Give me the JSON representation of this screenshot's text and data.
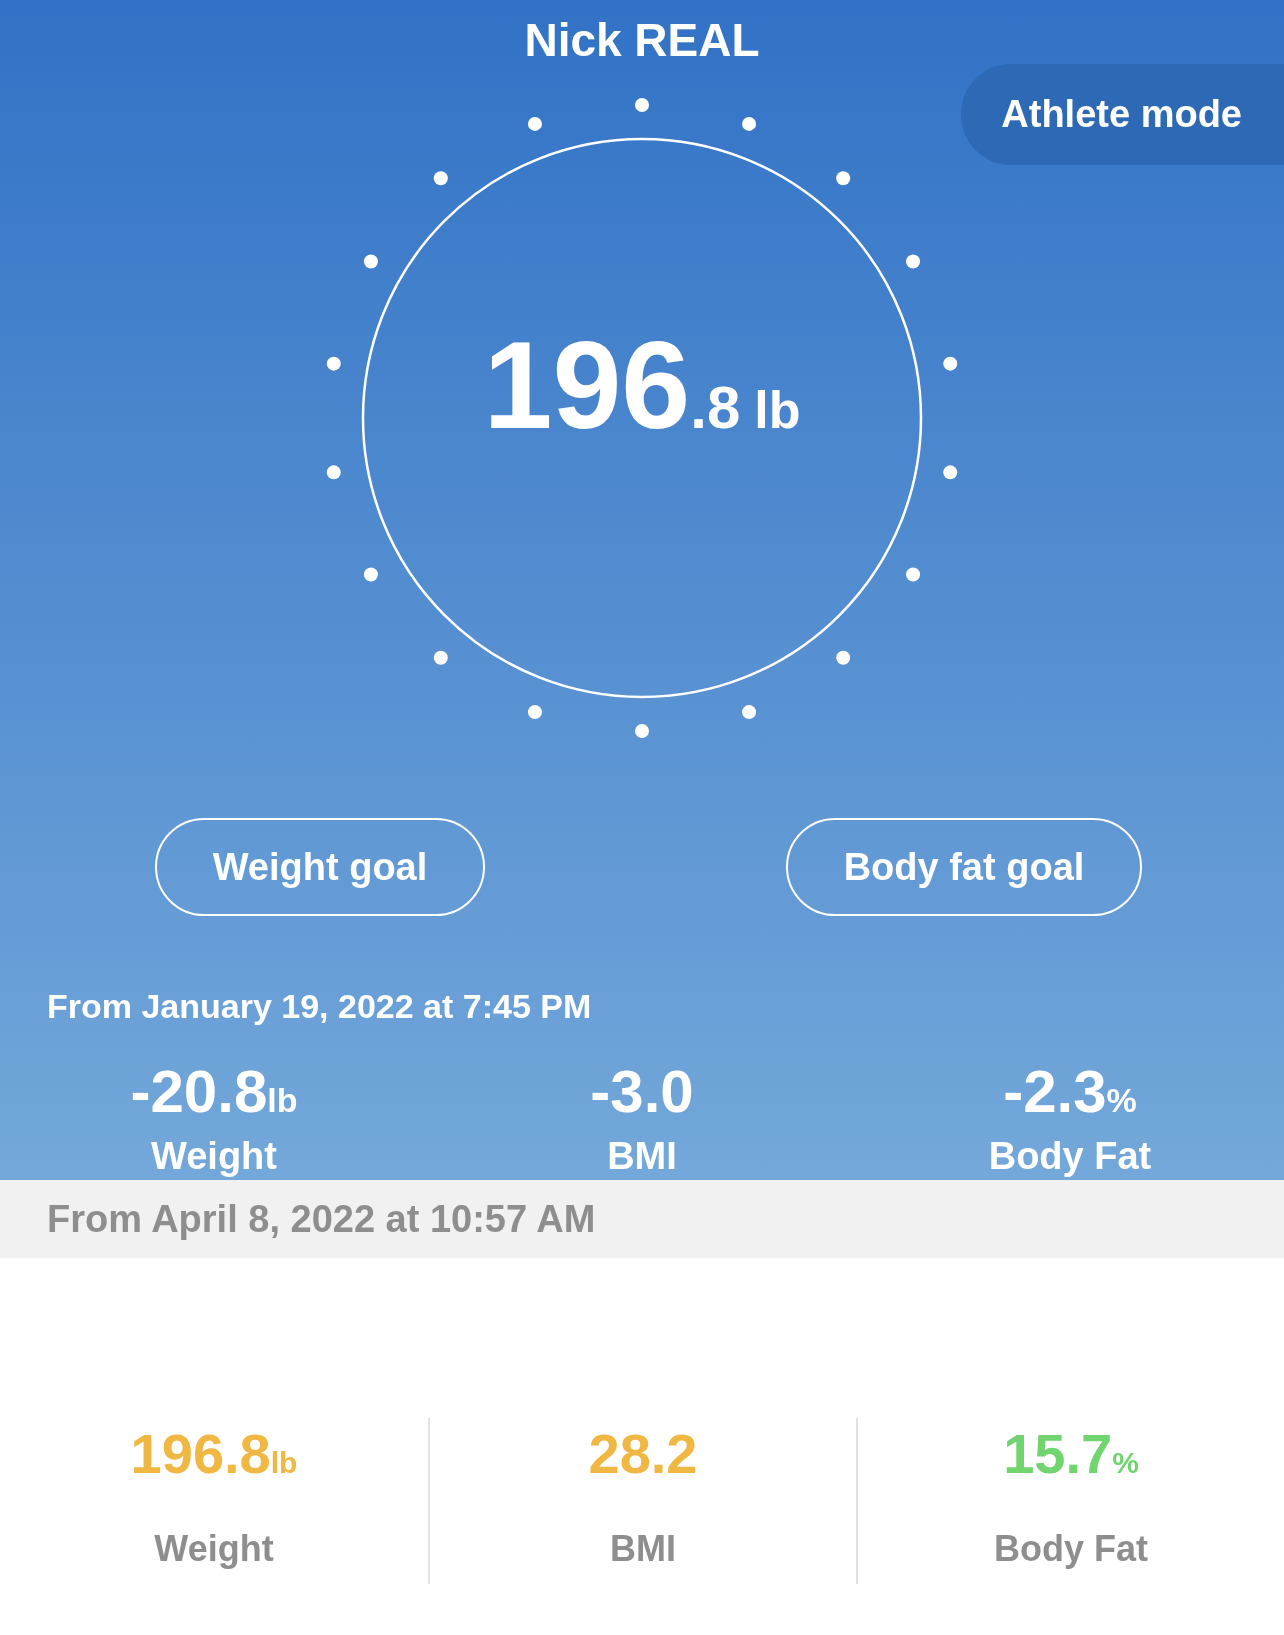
{
  "title": "Nick REAL",
  "mode_button": {
    "label": "Athlete mode"
  },
  "reading": {
    "whole": "196",
    "decimal": ".8",
    "unit": "lb"
  },
  "goals": [
    {
      "label": "Weight goal"
    },
    {
      "label": "Body fat goal"
    }
  ],
  "change": {
    "since": "From January 19, 2022 at 7:45 PM",
    "stats": [
      {
        "value": "-20.8",
        "unit": "lb",
        "label": "Weight"
      },
      {
        "value": "-3.0",
        "label": "BMI"
      },
      {
        "value": "-2.3",
        "unit": "%",
        "label": "Body Fat"
      }
    ]
  },
  "latest": {
    "since": "From April 8, 2022 at 10:57 AM",
    "stats": [
      {
        "value": "196.8",
        "unit": "lb",
        "label": "Weight",
        "color": "#f0b743"
      },
      {
        "value": "28.2",
        "label": "BMI",
        "color": "#f0b743"
      },
      {
        "value": "15.7",
        "unit": "%",
        "label": "Body Fat",
        "color": "#72d46e"
      }
    ]
  }
}
